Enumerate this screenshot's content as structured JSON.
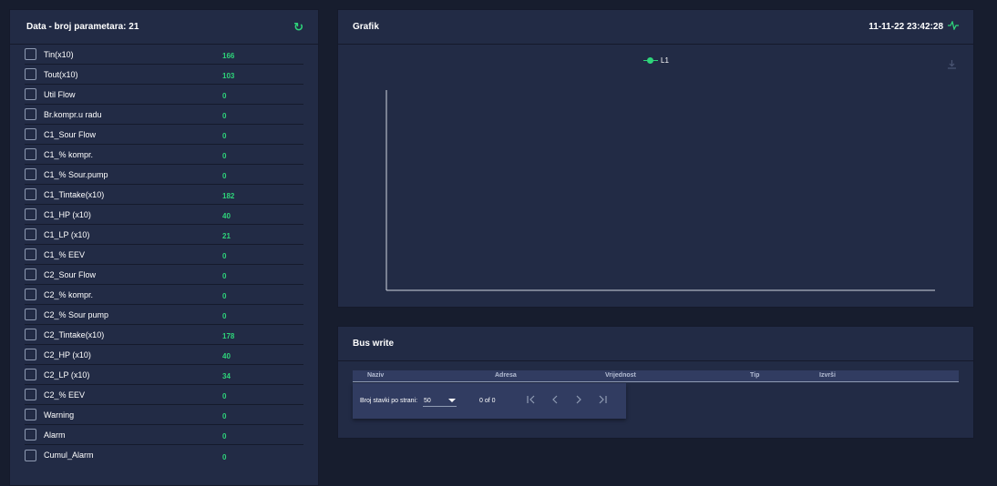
{
  "data_panel": {
    "title": "Data - broj parametara: 21",
    "refresh_icon": "refresh-icon",
    "params": [
      {
        "name": "Tin(x10)",
        "value": "166"
      },
      {
        "name": "Tout(x10)",
        "value": "103"
      },
      {
        "name": "Util Flow",
        "value": "0"
      },
      {
        "name": "Br.kompr.u radu",
        "value": "0"
      },
      {
        "name": "C1_Sour Flow",
        "value": "0"
      },
      {
        "name": "C1_% kompr.",
        "value": "0"
      },
      {
        "name": "C1_% Sour.pump",
        "value": "0"
      },
      {
        "name": "C1_Tintake(x10)",
        "value": "182"
      },
      {
        "name": "C1_HP (x10)",
        "value": "40"
      },
      {
        "name": "C1_LP (x10)",
        "value": "21"
      },
      {
        "name": "C1_% EEV",
        "value": "0"
      },
      {
        "name": "C2_Sour Flow",
        "value": "0"
      },
      {
        "name": "C2_% kompr.",
        "value": "0"
      },
      {
        "name": "C2_% Sour pump",
        "value": "0"
      },
      {
        "name": "C2_Tintake(x10)",
        "value": "178"
      },
      {
        "name": "C2_HP (x10)",
        "value": "40"
      },
      {
        "name": "C2_LP (x10)",
        "value": "34"
      },
      {
        "name": "C2_% EEV",
        "value": "0"
      },
      {
        "name": "Warning",
        "value": "0"
      },
      {
        "name": "Alarm",
        "value": "0"
      },
      {
        "name": "Cumul_Alarm",
        "value": "0"
      }
    ]
  },
  "chart_panel": {
    "title": "Grafik",
    "timestamp": "11-11-22 23:42:28",
    "pulse_icon": "pulse-icon",
    "download_icon": "download-icon"
  },
  "chart_data": {
    "type": "line",
    "series": [
      {
        "name": "L1",
        "values": []
      }
    ],
    "legend": "top-center",
    "grid": false
  },
  "bus_panel": {
    "title": "Bus write",
    "columns": [
      "Naziv",
      "Adresa",
      "Vrijednost",
      "Tip",
      "Izvrši"
    ],
    "paginator": {
      "per_page_label": "Broj stavki po strani:",
      "per_page_value": "50",
      "range_label": "0 of 0"
    }
  },
  "colors": {
    "background": "#171d2e",
    "panel": "#222b45",
    "accent": "#2ed47a"
  }
}
